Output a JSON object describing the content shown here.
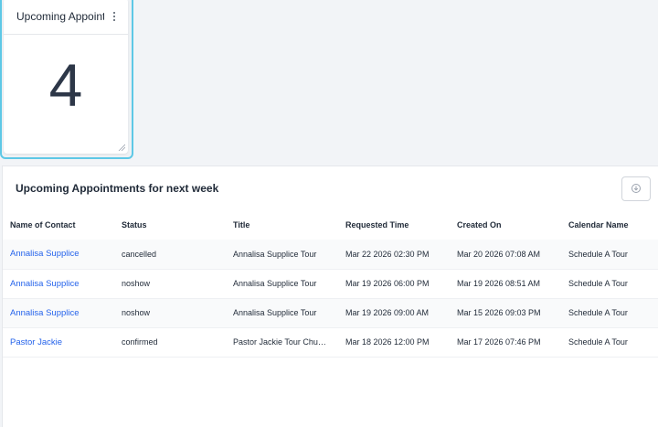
{
  "widget": {
    "title": "Upcoming Appointments",
    "value": "4"
  },
  "table_panel": {
    "title": "Upcoming Appointments for next week",
    "columns": [
      "Name of Contact",
      "Status",
      "Title",
      "Requested Time",
      "Created On",
      "Calendar Name"
    ],
    "rows": [
      [
        "Annalisa Supplice",
        "cancelled",
        "Annalisa Supplice Tour",
        "Mar 22 2026 02:30 PM",
        "Mar 20 2026 07:08 AM",
        "Schedule A Tour"
      ],
      [
        "Annalisa Supplice",
        "noshow",
        "Annalisa Supplice Tour",
        "Mar 19 2026 06:00 PM",
        "Mar 19 2026 08:51 AM",
        "Schedule A Tour"
      ],
      [
        "Annalisa Supplice",
        "noshow",
        "Annalisa Supplice Tour",
        "Mar 19 2026 09:00 AM",
        "Mar 15 2026 09:03 PM",
        "Schedule A Tour"
      ],
      [
        "Pastor Jackie",
        "confirmed",
        "Pastor Jackie Tour Chu…",
        "Mar 18 2026 12:00 PM",
        "Mar 17 2026 07:46 PM",
        "Schedule A Tour"
      ]
    ]
  },
  "colors": {
    "accent": "#5ec8e6",
    "link": "#2563eb"
  },
  "icons": {
    "widget_menu": "kebab-menu-icon",
    "download": "download-icon",
    "resize": "resize-handle-icon"
  }
}
